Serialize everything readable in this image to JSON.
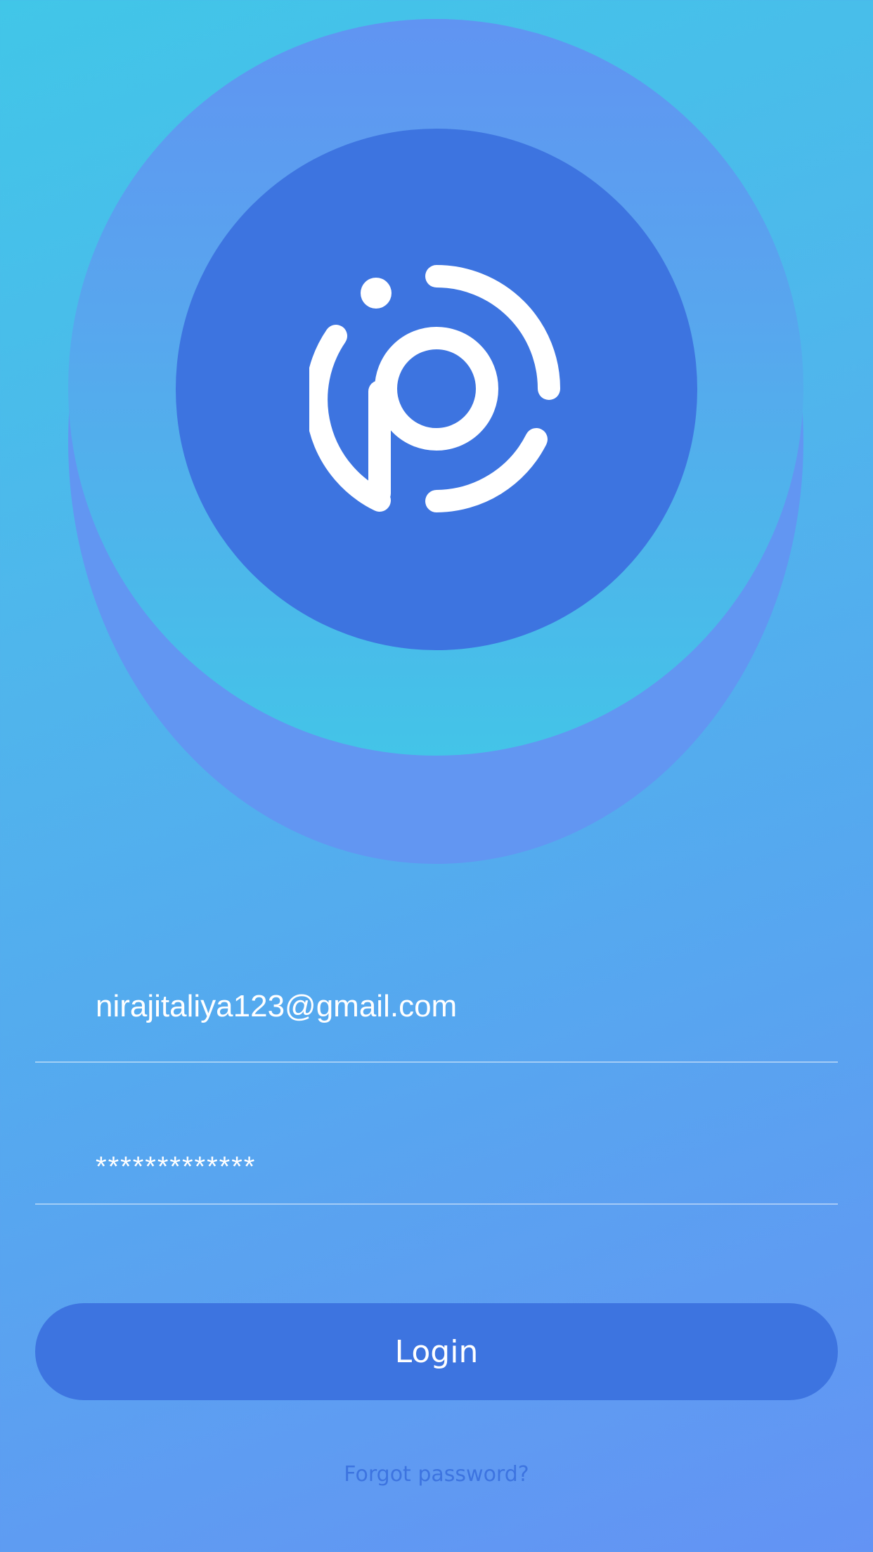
{
  "colors": {
    "background_top": "#41c6e8",
    "background_bottom": "#6393f4",
    "ring_outer": "#6296f2",
    "ring_inner": "#43c4e8",
    "logo_circle": "#3d74e0",
    "button": "#3d74e0",
    "link": "#3d74e0",
    "text": "#ffffff"
  },
  "logo": {
    "icon": "ip-logo-icon"
  },
  "form": {
    "email_value": "nirajitaliya123@gmail.com",
    "password_value": "*************"
  },
  "actions": {
    "login_label": "Login",
    "forgot_label": "Forgot password?"
  }
}
